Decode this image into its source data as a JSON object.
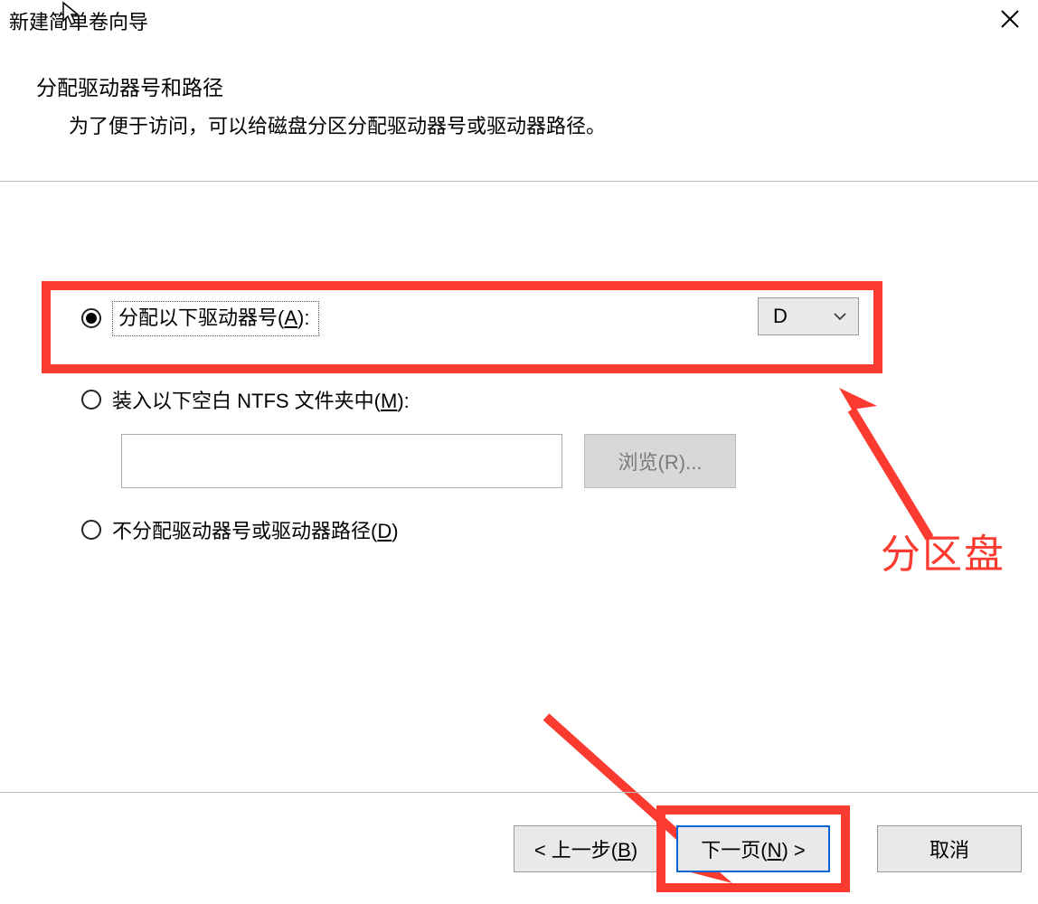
{
  "titlebar": {
    "title": "新建简单卷向导"
  },
  "header": {
    "heading": "分配驱动器号和路径",
    "sub": "为了便于访问，可以给磁盘分区分配驱动器号或驱动器路径。"
  },
  "options": {
    "assign_letter": {
      "label_pre": "分配以下驱动器号(",
      "label_key": "A",
      "label_post": "):",
      "selected_drive": "D"
    },
    "mount_folder": {
      "label_pre": "装入以下空白 NTFS 文件夹中(",
      "label_key": "M",
      "label_post": "):",
      "path_value": "",
      "browse_pre": "浏览(",
      "browse_key": "R",
      "browse_post": ")..."
    },
    "no_assign": {
      "label_pre": "不分配驱动器号或驱动器路径(",
      "label_key": "D",
      "label_post": ")"
    }
  },
  "annotation": {
    "label": "分区盘"
  },
  "footer": {
    "back_pre": "< 上一步(",
    "back_key": "B",
    "back_post": ")",
    "next_pre": "下一页(",
    "next_key": "N",
    "next_post": ") >",
    "cancel": "取消"
  }
}
